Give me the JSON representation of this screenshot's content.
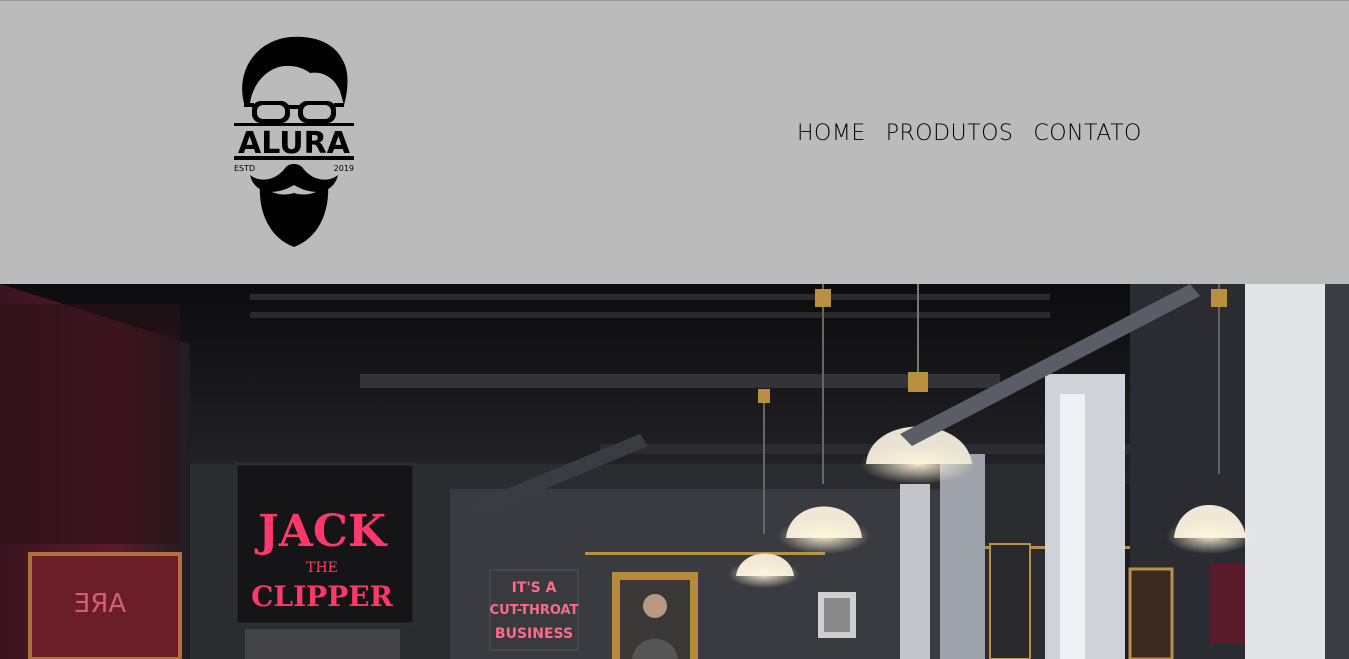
{
  "logo": {
    "brand": "ALURA",
    "estd": "ESTD",
    "year": "2019"
  },
  "nav": {
    "items": [
      {
        "label": "HOME"
      },
      {
        "label": "PRODUTOS"
      },
      {
        "label": "CONTATO"
      }
    ]
  },
  "hero": {
    "neon_sign": {
      "line1": "JACK",
      "line2": "THE",
      "line3": "CLIPPER"
    },
    "poster": {
      "line1": "IT'S A",
      "line2": "CUT-THROAT",
      "line3": "BUSINESS"
    }
  },
  "colors": {
    "header_bg": "#bbbbbb",
    "neon": "#ff3a6a",
    "hero_dark": "#1c1c1e"
  }
}
